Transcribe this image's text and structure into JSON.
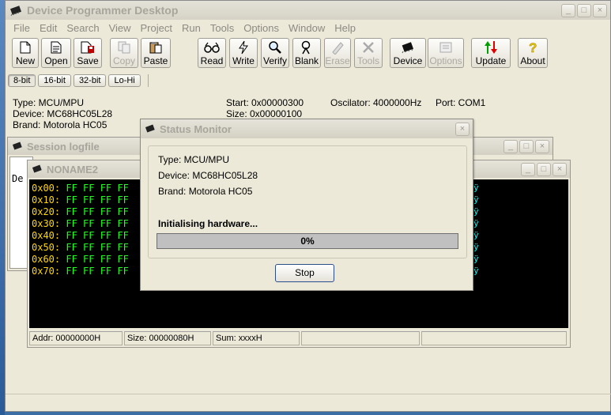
{
  "app": {
    "title": "Device Programmer Desktop",
    "window_buttons": [
      "_",
      "□",
      "×"
    ]
  },
  "menu": [
    "File",
    "Edit",
    "Search",
    "View",
    "Project",
    "Run",
    "Tools",
    "Options",
    "Window",
    "Help"
  ],
  "toolbar": {
    "new": "New",
    "open": "Open",
    "save": "Save",
    "copy": "Copy",
    "paste": "Paste",
    "read": "Read",
    "write": "Write",
    "verify": "Verify",
    "blank": "Blank",
    "erase": "Erase",
    "tools": "Tools",
    "device": "Device",
    "options": "Options",
    "update": "Update",
    "about": "About"
  },
  "width_buttons": [
    "8-bit",
    "16-bit",
    "32-bit",
    "Lo-Hi"
  ],
  "info": {
    "type": "Type: MCU/MPU",
    "device": "Device: MC68HC05L28",
    "brand": "Brand: Motorola HC05",
    "start": "Start: 0x00000300",
    "size": "Size: 0x00000100",
    "oscillator": "Oscilator: 4000000Hz",
    "port": "Port: COM1"
  },
  "session_window": {
    "title": "Session logfile",
    "text": "De"
  },
  "hex_window": {
    "title": "NONAME2",
    "rows": [
      {
        "addr": "0x00:",
        "bytes": "FF FF FF FF"
      },
      {
        "addr": "0x10:",
        "bytes": "FF FF FF FF"
      },
      {
        "addr": "0x20:",
        "bytes": "FF FF FF FF"
      },
      {
        "addr": "0x30:",
        "bytes": "FF FF FF FF"
      },
      {
        "addr": "0x40:",
        "bytes": "FF FF FF FF"
      },
      {
        "addr": "0x50:",
        "bytes": "FF FF FF FF"
      },
      {
        "addr": "0x60:",
        "bytes": "FF FF FF FF"
      },
      {
        "addr": "0x70:",
        "bytes": "FF FF FF FF"
      }
    ],
    "ascii_glyph": "ÿ",
    "status": {
      "addr": "Addr: 00000000H",
      "size": "Size: 00000080H",
      "sum": "Sum: xxxxH"
    }
  },
  "status_monitor": {
    "title": "Status Monitor",
    "type": "Type: MCU/MPU",
    "device": "Device: MC68HC05L28",
    "brand": "Brand: Motorola HC05",
    "message": "Initialising hardware...",
    "progress_percent": 0,
    "progress_label": "0%",
    "stop_label": "Stop",
    "close": "×"
  }
}
